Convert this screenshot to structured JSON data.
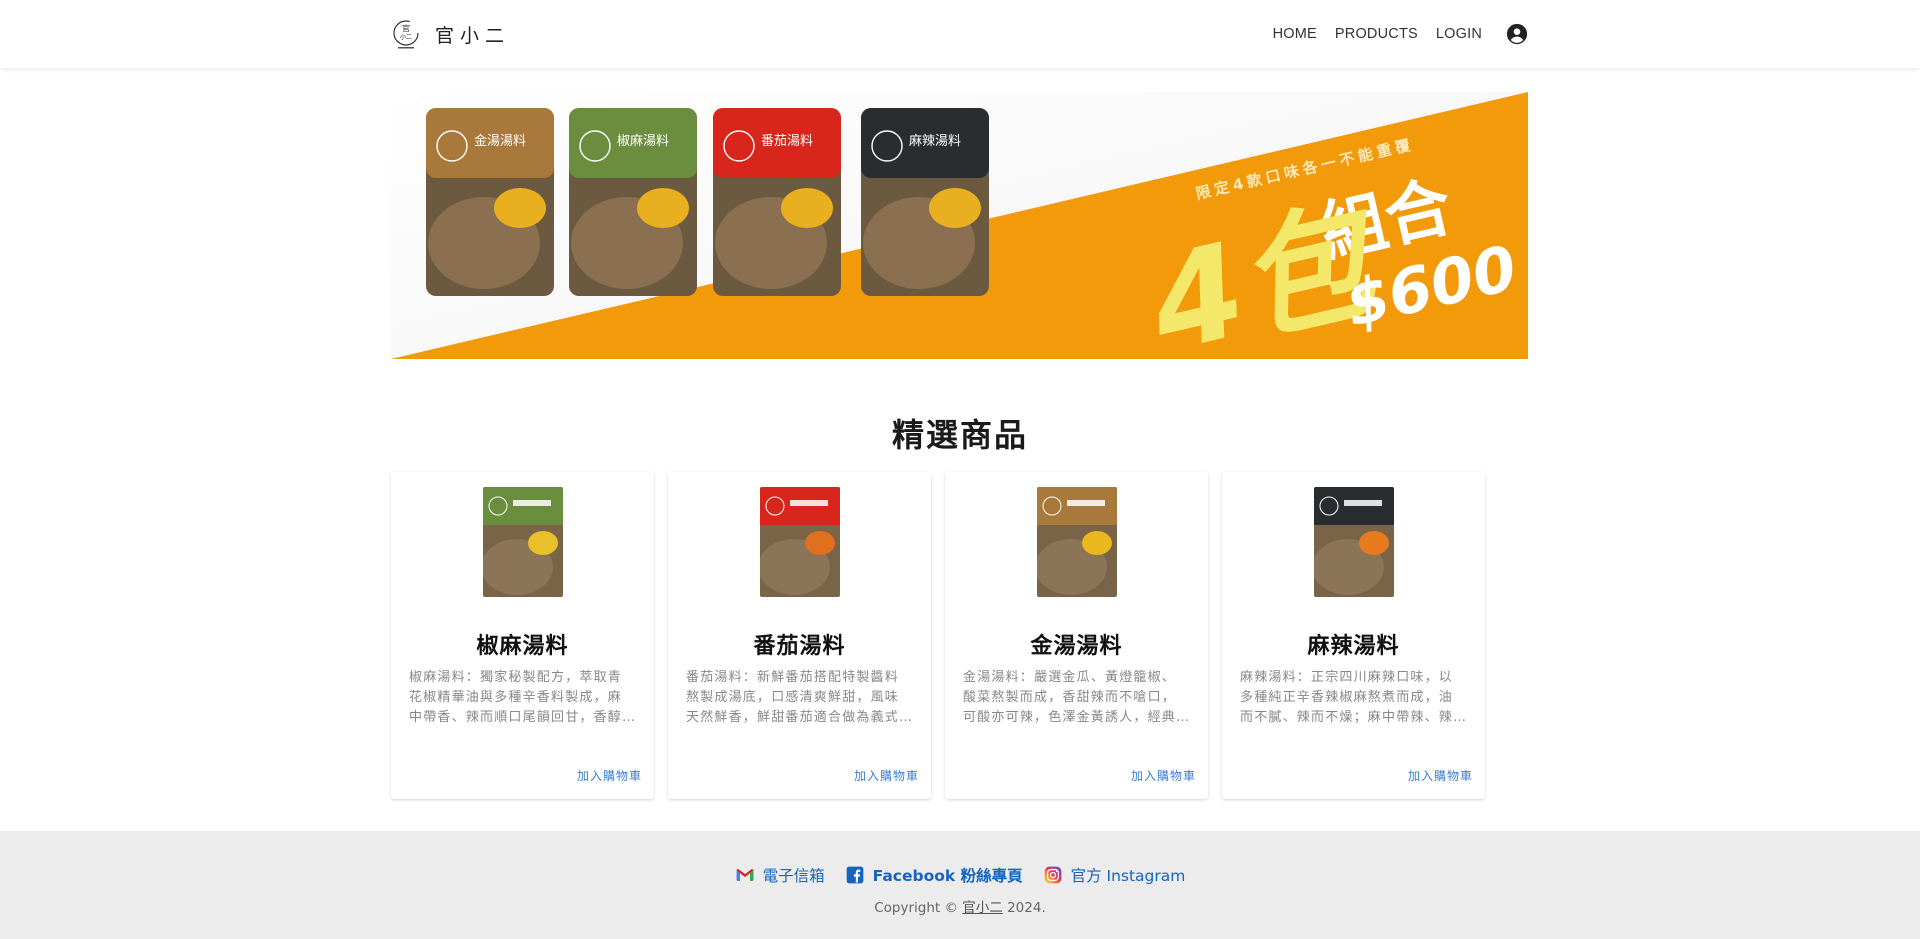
{
  "header": {
    "brand_name": "官小二",
    "nav": {
      "home": "HOME",
      "products": "PRODUCTS",
      "login": "LOGIN"
    }
  },
  "banner": {
    "tagline": "限定4款口味各一不能重覆",
    "headline_count": "4包",
    "headline_combo": "組合",
    "price": "$600",
    "packs": [
      {
        "name": "金湯湯料",
        "color": "#a8793a"
      },
      {
        "name": "椒麻湯料",
        "color": "#6b8e3e"
      },
      {
        "name": "番茄湯料",
        "color": "#d9261c"
      },
      {
        "name": "麻辣湯料",
        "color": "#2a2d30"
      }
    ],
    "accent": "#f29a0a",
    "headline_color": "#f3e86a"
  },
  "featured": {
    "title": "精選商品",
    "products": [
      {
        "name": "椒麻湯料",
        "description": "椒麻湯料：獨家秘製配方，萃取青花椒精華油與多種辛香料製成，麻中帶香、辣而順口尾韻回甘，香醇富有層次。",
        "action": "加入購物車",
        "color": "#6b8e3e",
        "soup": "#e8c02a"
      },
      {
        "name": "番茄湯料",
        "description": "番茄湯料：新鮮番茄搭配特製醬料熬製成湯底，口感清爽鮮甜，風味天然鮮香，鮮甜番茄適合做為義式料理湯底。",
        "action": "加入購物車",
        "color": "#d9261c",
        "soup": "#e0701e"
      },
      {
        "name": "金湯湯料",
        "description": "金湯湯料：嚴選金瓜、黃燈籠椒、酸菜熬製而成，香甜辣而不嗆口，可酸亦可辣，色澤金黃誘人，經典招牌湯頭。",
        "action": "加入購物車",
        "color": "#a8793a",
        "soup": "#e8b81e"
      },
      {
        "name": "麻辣湯料",
        "description": "麻辣湯料：正宗四川麻辣口味，以多種純正辛香辣椒麻熬煮而成，油而不膩、辣而不燥；麻中帶辣、辣中帶香。",
        "action": "加入購物車",
        "color": "#2a2d30",
        "soup": "#e87a1e"
      }
    ]
  },
  "footer": {
    "email_label": "電子信箱",
    "facebook_label": "Facebook 粉絲專頁",
    "instagram_label": "官方 Instagram",
    "copyright_prefix": "Copyright ©",
    "copyright_brand": "官小二",
    "copyright_year": "2024."
  }
}
